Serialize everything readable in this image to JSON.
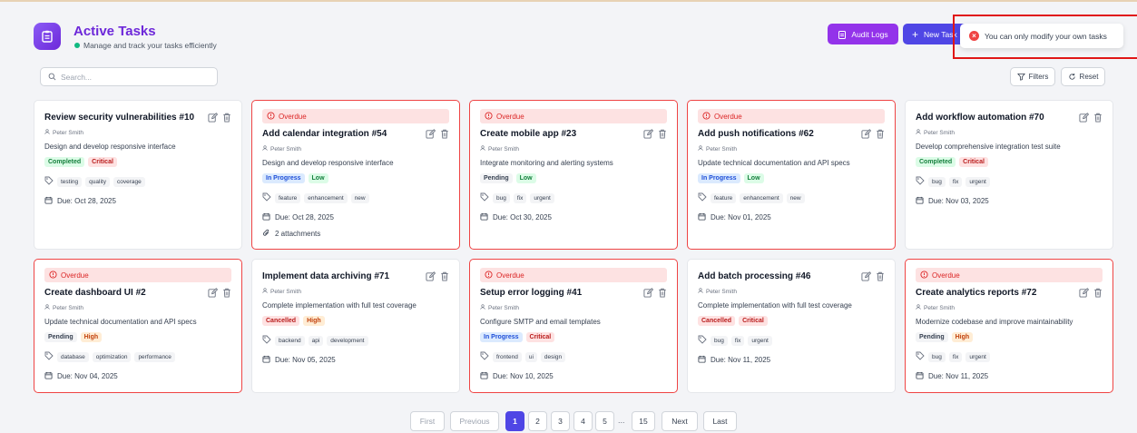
{
  "header": {
    "title": "Active Tasks",
    "subtitle": "Manage and track your tasks efficiently",
    "audit_label": "Audit Logs",
    "new_label": "New Task"
  },
  "toast": {
    "message": "You can only modify your own tasks"
  },
  "toolbar": {
    "search_placeholder": "Search...",
    "filters_label": "Filters",
    "reset_label": "Reset"
  },
  "overdue_label": "Overdue",
  "colors": {
    "accent": "#4f46e5",
    "brand": "#7c3aed",
    "overdue": "#ef4444"
  },
  "cards": [
    {
      "title": "Review security vulnerabilities #10",
      "assignee": "Peter Smith",
      "description": "Design and develop responsive interface",
      "status": "Completed",
      "priority": "Critical",
      "tags": [
        "testing",
        "quality",
        "coverage"
      ],
      "due": "Due: Oct 28, 2025",
      "overdue": false
    },
    {
      "title": "Add calendar integration #54",
      "assignee": "Peter Smith",
      "description": "Design and develop responsive interface",
      "status": "In Progress",
      "priority": "Low",
      "tags": [
        "feature",
        "enhancement",
        "new"
      ],
      "due": "Due: Oct 28, 2025",
      "attachments": "2 attachments",
      "overdue": true
    },
    {
      "title": "Create mobile app #23",
      "assignee": "Peter Smith",
      "description": "Integrate monitoring and alerting systems",
      "status": "Pending",
      "priority": "Low",
      "tags": [
        "bug",
        "fix",
        "urgent"
      ],
      "due": "Due: Oct 30, 2025",
      "overdue": true
    },
    {
      "title": "Add push notifications #62",
      "assignee": "Peter Smith",
      "description": "Update technical documentation and API specs",
      "status": "In Progress",
      "priority": "Low",
      "tags": [
        "feature",
        "enhancement",
        "new"
      ],
      "due": "Due: Nov 01, 2025",
      "overdue": true
    },
    {
      "title": "Add workflow automation #70",
      "assignee": "Peter Smith",
      "description": "Develop comprehensive integration test suite",
      "status": "Completed",
      "priority": "Critical",
      "tags": [
        "bug",
        "fix",
        "urgent"
      ],
      "due": "Due: Nov 03, 2025",
      "overdue": false
    },
    {
      "title": "Create dashboard UI #2",
      "assignee": "Peter Smith",
      "description": "Update technical documentation and API specs",
      "status": "Pending",
      "priority": "High",
      "tags": [
        "database",
        "optimization",
        "performance"
      ],
      "due": "Due: Nov 04, 2025",
      "overdue": true
    },
    {
      "title": "Implement data archiving #71",
      "assignee": "Peter Smith",
      "description": "Complete implementation with full test coverage",
      "status": "Cancelled",
      "priority": "High",
      "tags": [
        "backend",
        "api",
        "development"
      ],
      "due": "Due: Nov 05, 2025",
      "overdue": false
    },
    {
      "title": "Setup error logging #41",
      "assignee": "Peter Smith",
      "description": "Configure SMTP and email templates",
      "status": "In Progress",
      "priority": "Critical",
      "tags": [
        "frontend",
        "ui",
        "design"
      ],
      "due": "Due: Nov 10, 2025",
      "overdue": true
    },
    {
      "title": "Add batch processing #46",
      "assignee": "Peter Smith",
      "description": "Complete implementation with full test coverage",
      "status": "Cancelled",
      "priority": "Critical",
      "tags": [
        "bug",
        "fix",
        "urgent"
      ],
      "due": "Due: Nov 11, 2025",
      "overdue": false
    },
    {
      "title": "Create analytics reports #72",
      "assignee": "Peter Smith",
      "description": "Modernize codebase and improve maintainability",
      "status": "Pending",
      "priority": "High",
      "tags": [
        "bug",
        "fix",
        "urgent"
      ],
      "due": "Due: Nov 11, 2025",
      "overdue": true
    }
  ],
  "pagination": {
    "first": "First",
    "previous": "Previous",
    "next": "Next",
    "last": "Last",
    "pages": [
      "1",
      "2",
      "3",
      "4",
      "5"
    ],
    "ellipsis": "...",
    "last_page": "15",
    "current": "1"
  }
}
